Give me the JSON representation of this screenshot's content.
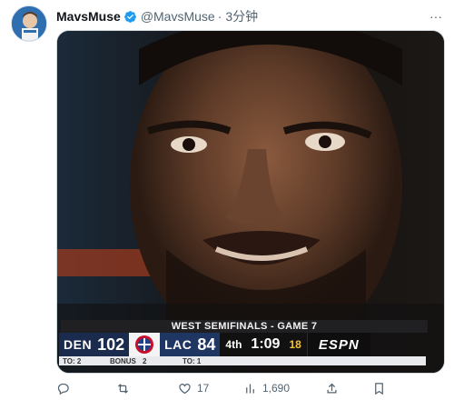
{
  "tweet": {
    "display_name": "MavsMuse",
    "handle": "@MavsMuse",
    "separator": "·",
    "time": "3分钟",
    "more": "···"
  },
  "scorebug": {
    "title": "WEST SEMIFINALS - GAME 7",
    "away_abbr": "DEN",
    "away_score": "102",
    "home_abbr": "LAC",
    "home_score": "84",
    "period": "4th",
    "clock": "1:09",
    "shot_clock": "18",
    "network": "ESPN",
    "away_timeouts": "TO: 2",
    "bonus": "BONUS",
    "bonus_num": "2",
    "home_timeouts": "TO: 1"
  },
  "actions": {
    "reply_count": "",
    "retweet_count": "",
    "like_count": "17",
    "views_count": "1,690"
  },
  "colors": {
    "verified": "#1d9bf0",
    "muted": "#536471"
  }
}
